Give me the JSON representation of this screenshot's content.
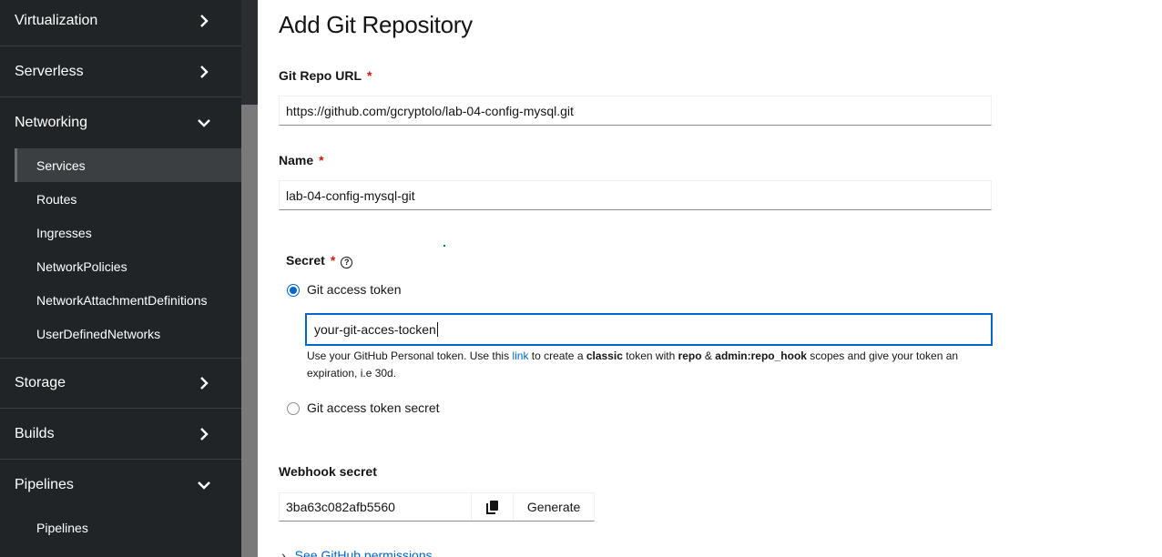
{
  "sidebar": {
    "sections": {
      "virtualization": "Virtualization",
      "serverless": "Serverless",
      "networking": "Networking",
      "storage": "Storage",
      "builds": "Builds",
      "pipelines": "Pipelines"
    },
    "networking_items": [
      "Services",
      "Routes",
      "Ingresses",
      "NetworkPolicies",
      "NetworkAttachmentDefinitions",
      "UserDefinedNetworks"
    ],
    "pipelines_items": [
      "Pipelines"
    ]
  },
  "form": {
    "title": "Add Git Repository",
    "git_url_label": "Git Repo URL",
    "git_url_value": "https://github.com/gcryptolo/lab-04-config-mysql.git",
    "name_label": "Name",
    "name_value": "lab-04-config-mysql-git",
    "required_marker": "*",
    "secret_label": "Secret",
    "help_icon_glyph": "?",
    "radio_token_label": "Git access token",
    "token_value": "your-git-acces-tocken",
    "helper": {
      "p1": "Use your GitHub Personal token. Use this ",
      "link": "link",
      "p2": " to create a ",
      "classic": "classic",
      "p3": " token with ",
      "repo": "repo",
      "amp": " & ",
      "admin_hook": "admin:repo_hook",
      "p4": " scopes and give your token an expiration, i.e 30d."
    },
    "radio_secret_label": "Git access token secret",
    "webhook_label": "Webhook secret",
    "webhook_value": "3ba63c082afb5560",
    "generate_label": "Generate",
    "see_github_link": "See GitHub permissions"
  },
  "colors": {
    "sidebar_bg": "#212427",
    "accent": "#0066cc",
    "required": "#c9190b"
  },
  "icons": {
    "chevron_right": "chevron-right-icon",
    "chevron_down": "chevron-down-icon",
    "copy": "copy-icon",
    "help": "help-icon"
  }
}
